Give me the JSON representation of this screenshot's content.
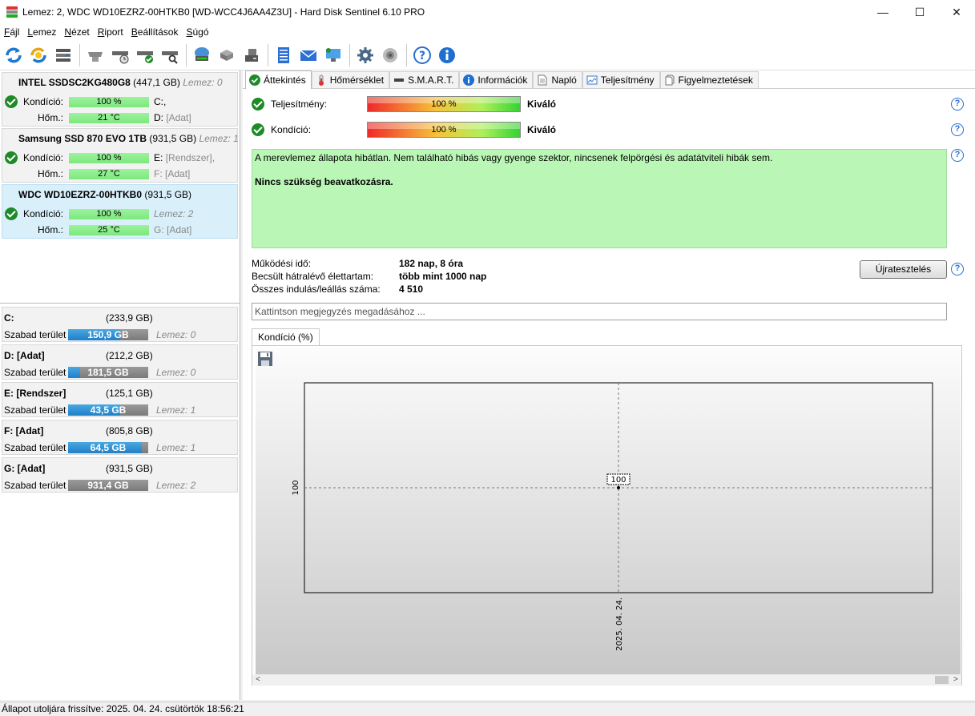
{
  "window": {
    "title": "Lemez: 2, WDC WD10EZRZ-00HTKB0 [WD-WCC4J6AA4Z3U]  -  Hard Disk Sentinel 6.10 PRO",
    "min_glyph": "—",
    "max_glyph": "☐",
    "close_glyph": "✕"
  },
  "menu": {
    "items": [
      {
        "underline": "F",
        "rest": "ájl"
      },
      {
        "underline": "L",
        "rest": "emez"
      },
      {
        "underline": "N",
        "rest": "ézet"
      },
      {
        "underline": "R",
        "rest": "iport"
      },
      {
        "underline": "B",
        "rest": "eállítások"
      },
      {
        "underline": "S",
        "rest": "úgó"
      }
    ]
  },
  "disks": [
    {
      "name": "INTEL SSDSC2KG480G8",
      "size": "(447,1 GB)",
      "disk_no": "Lemez: 0",
      "condition_label": "Kondíció:",
      "condition": "100 %",
      "temp_label": "Hőm.:",
      "temp": "21 °C",
      "vol1": "C:,",
      "vol2_letter": "D:",
      "vol2_name": "[Adat]"
    },
    {
      "name": "Samsung SSD 870 EVO 1TB",
      "size": "(931,5 GB)",
      "disk_no": "Lemez: 1",
      "condition_label": "Kondíció:",
      "condition": "100 %",
      "temp_label": "Hőm.:",
      "temp": "27 °C",
      "vol1_letter": "E:",
      "vol1_name": "[Rendszer],",
      "vol2_letter": "F:",
      "vol2_name": "[Adat]"
    },
    {
      "name": "WDC WD10EZRZ-00HTKB0",
      "size": "(931,5 GB)",
      "disk_no": "Lemez: 2",
      "condition_label": "Kondíció:",
      "condition": "100 %",
      "temp_label": "Hőm.:",
      "temp": "25 °C",
      "vol2_letter": "G:",
      "vol2_name": "[Adat]"
    }
  ],
  "volumes": [
    {
      "name": "C:",
      "size": "(233,9 GB)",
      "free_label": "Szabad terület",
      "free": "150,9 GB",
      "free_fraction": 0.645,
      "disk": "Lemez: 0"
    },
    {
      "name": "D: [Adat]",
      "size": "(212,2 GB)",
      "free_label": "Szabad terület",
      "free": "181,5 GB",
      "free_fraction": 0.145,
      "disk": "Lemez: 0"
    },
    {
      "name": "E: [Rendszer]",
      "size": "(125,1 GB)",
      "free_label": "Szabad terület",
      "free": "43,5 GB",
      "free_fraction": 0.652,
      "disk": "Lemez: 1"
    },
    {
      "name": "F: [Adat]",
      "size": "(805,8 GB)",
      "free_label": "Szabad terület",
      "free": "64,5 GB",
      "free_fraction": 0.92,
      "disk": "Lemez: 1"
    },
    {
      "name": "G: [Adat]",
      "size": "(931,5 GB)",
      "free_label": "Szabad terület",
      "free": "931,4 GB",
      "free_fraction": 0.0,
      "disk": "Lemez: 2"
    }
  ],
  "tabs": [
    "Áttekintés",
    "Hőmérséklet",
    "S.M.A.R.T.",
    "Információk",
    "Napló",
    "Teljesítmény",
    "Figyelmeztetések"
  ],
  "overview": {
    "performance_label": "Teljesítmény:",
    "performance_value": "100 %",
    "performance_rating": "Kiváló",
    "condition_label": "Kondíció:",
    "condition_value": "100 %",
    "condition_rating": "Kiváló",
    "message": "A merevlemez állapota hibátlan. Nem található hibás vagy gyenge szektor, nincsenek felpörgési és adatátviteli hibák sem.",
    "advice": "Nincs szükség beavatkozásra.",
    "uptime_label": "Működési idő:",
    "uptime": "182 nap, 8 óra",
    "lifetime_label": "Becsült hátralévő élettartam:",
    "lifetime": "több mint 1000 nap",
    "starts_label": "Összes indulás/leállás száma:",
    "starts": "4 510",
    "retest_label": "Újratesztelés",
    "note_placeholder": "Kattintson megjegyzés megadásához ...",
    "help_glyph": "?"
  },
  "chart_data": {
    "type": "line",
    "tab_label": "Kondíció  (%)",
    "x": [
      "2025. 04. 24."
    ],
    "series": [
      {
        "values": [
          100
        ]
      }
    ],
    "y_tick": "100",
    "x_tick": "2025. 04. 24.",
    "data_label": "100"
  },
  "statusbar": {
    "text": "Állapot utoljára frissítve: 2025. 04. 24. csütörtök 18:56:21"
  },
  "scroll": {
    "left": "<",
    "right": ">"
  }
}
